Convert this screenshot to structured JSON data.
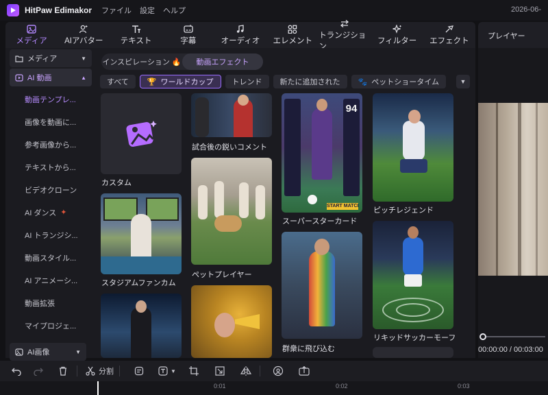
{
  "app": {
    "name": "HitPaw Edimakor",
    "menus": [
      "ファイル",
      "設定",
      "ヘルプ"
    ],
    "date": "2026-06-"
  },
  "toolbar": {
    "tools": [
      {
        "label": "メディア",
        "icon": "media-icon",
        "active": true
      },
      {
        "label": "AIアバター",
        "icon": "ai-avatar-icon"
      },
      {
        "label": "テキスト",
        "icon": "text-icon"
      },
      {
        "label": "字幕",
        "icon": "subtitle-icon"
      },
      {
        "label": "オーディオ",
        "icon": "audio-icon"
      },
      {
        "label": "エレメント",
        "icon": "element-icon"
      },
      {
        "label": "トランジション",
        "icon": "transition-icon"
      },
      {
        "label": "フィルター",
        "icon": "filter-icon"
      },
      {
        "label": "エフェクト",
        "icon": "effect-icon"
      }
    ]
  },
  "sidebar": {
    "media_label": "メディア",
    "ai_video_label": "AI 動画",
    "items": [
      "動画テンプレ...",
      "画像を動画に...",
      "参考画像から...",
      "テキストから...",
      "ビデオクローン",
      "AI ダンス",
      "AI トランジシ...",
      "動画スタイル...",
      "AI アニメーシ...",
      "動画拡張",
      "マイプロジェ..."
    ],
    "ai_image_label": "AI画像"
  },
  "content": {
    "tabs": [
      "インスピレーション",
      "動画エフェクト"
    ],
    "inspiration_emoji": "🔥",
    "filters": [
      "すべて",
      "ワールドカップ",
      "トレンド",
      "新たに追加された",
      "ペットショータイム"
    ],
    "cards": [
      "カスタム",
      "試合後の鋭いコメント",
      "スーパースターカード",
      "ピッチレジェンド",
      "スタジアムファンカム",
      "ペットプレイヤー",
      "リキッドサッカーモーフ",
      "群衆に飛び込む"
    ],
    "card_text": {
      "rating": "94",
      "start_match": "START MATCH"
    }
  },
  "player": {
    "title": "プレイヤー",
    "timecode": "00:00:00 / 00:03:00"
  },
  "bottom_toolbar": {
    "split_label": "分割"
  },
  "timeline": {
    "ticks": [
      "0:01",
      "0:02",
      "0:03"
    ]
  },
  "colors": {
    "accent": "#b388ff",
    "background": "#1b1b20"
  }
}
